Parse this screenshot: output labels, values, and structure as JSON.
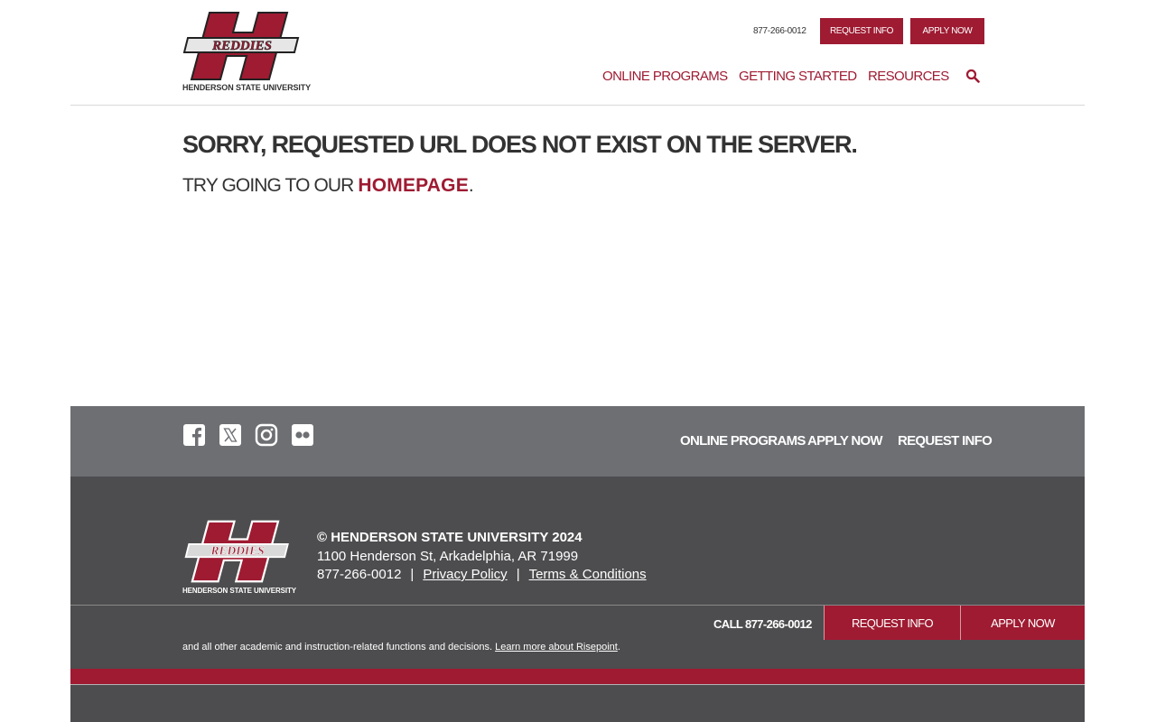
{
  "header": {
    "logo_text": "HENDERSON STATE UNIVERSITY",
    "phone": "877-266-0012",
    "request_label": "REQUEST INFO",
    "apply_label": "APPLY NOW",
    "nav": [
      "ONLINE PROGRAMS",
      "GETTING STARTED",
      "RESOURCES"
    ]
  },
  "main": {
    "title": "SORRY, REQUESTED URL DOES NOT EXIST ON THE SERVER.",
    "sub_prefix": "TRY GOING TO OUR ",
    "sub_link": "HOMEPAGE",
    "sub_suffix": "."
  },
  "footer": {
    "links": [
      "ONLINE PROGRAMS",
      "APPLY NOW",
      "REQUEST INFO"
    ],
    "logo_text": "HENDERSON STATE UNIVERSITY",
    "copyright": "© HENDERSON STATE UNIVERSITY 2024",
    "address": "1100 Henderson St, Arkadelphia, AR 71999",
    "phone": "877-266-0012",
    "privacy": "Privacy Policy",
    "terms": "Terms & Conditions",
    "sep": "|",
    "disclaimer": "and all other academic and instruction-related functions and decisions. ",
    "disclaimer_link": "Learn more about Risepoint",
    "disclaimer_end": "."
  },
  "sticky": {
    "call": "CALL 877-266-0012",
    "request": "REQUEST INFO",
    "apply": "APPLY NOW"
  },
  "colors": {
    "brand": "#9e1b32",
    "footer_dark": "#4d4d4f",
    "footer_mid": "#6d6f73"
  }
}
